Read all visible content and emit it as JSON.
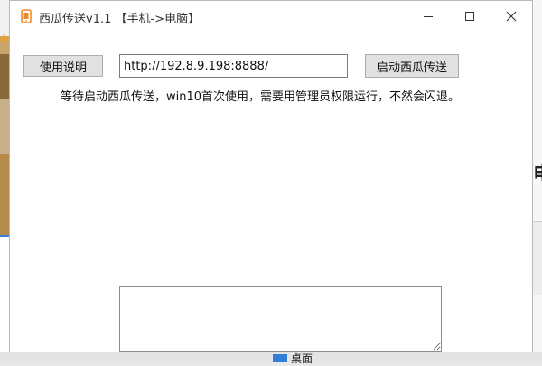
{
  "window": {
    "title": "西瓜传送v1.1 【手机->电脑】",
    "minimize_label": "",
    "maximize_label": "",
    "close_label": "✕"
  },
  "toolbar": {
    "help_button": "使用说明",
    "url_value": "http://192.8.9.198:8888/",
    "start_button": "启动西瓜传送"
  },
  "status_text": "等待启动西瓜传送，win10首次使用，需要用管理员权限运行，不然会闪退。",
  "log": {
    "value": ""
  },
  "background": {
    "right_fragment": "电",
    "desktop_item_label": "桌面"
  },
  "colors": {
    "button_bg": "#e1e1e1",
    "icon_orange": "#f08a24",
    "desktop_icon": "#2f7fd6"
  },
  "icons": {
    "app": "watermelon-transfer-icon",
    "minimize": "minimize-icon",
    "maximize": "maximize-icon",
    "close": "close-icon"
  }
}
